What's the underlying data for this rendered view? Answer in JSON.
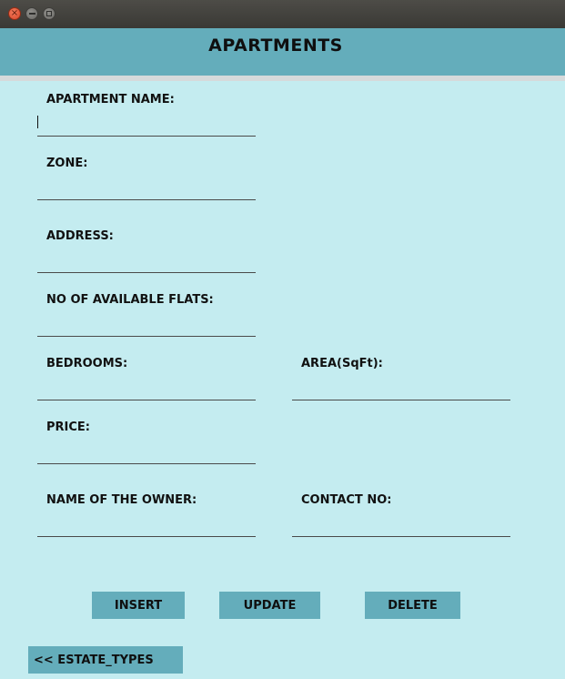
{
  "window": {
    "close_glyph": "×",
    "buttons": [
      "close",
      "minimize",
      "maximize"
    ]
  },
  "header": {
    "title": "APARTMENTS"
  },
  "form": {
    "apartment_name": {
      "label": "APARTMENT NAME:",
      "value": ""
    },
    "zone": {
      "label": "ZONE:",
      "value": ""
    },
    "address": {
      "label": "ADDRESS:",
      "value": ""
    },
    "available_flats": {
      "label": "NO OF AVAILABLE FLATS:",
      "value": ""
    },
    "bedrooms": {
      "label": "BEDROOMS:",
      "value": ""
    },
    "area": {
      "label": "AREA(SqFt):",
      "value": ""
    },
    "price": {
      "label": "PRICE:",
      "value": ""
    },
    "owner_name": {
      "label": "NAME OF THE OWNER:",
      "value": ""
    },
    "contact_no": {
      "label": "CONTACT NO:",
      "value": ""
    }
  },
  "actions": {
    "insert": "INSERT",
    "update": "UPDATE",
    "delete": "DELETE"
  },
  "nav": {
    "back": "<< ESTATE_TYPES"
  },
  "colors": {
    "background": "#c4ecf0",
    "header": "#64adbb",
    "button": "#64adbb"
  }
}
